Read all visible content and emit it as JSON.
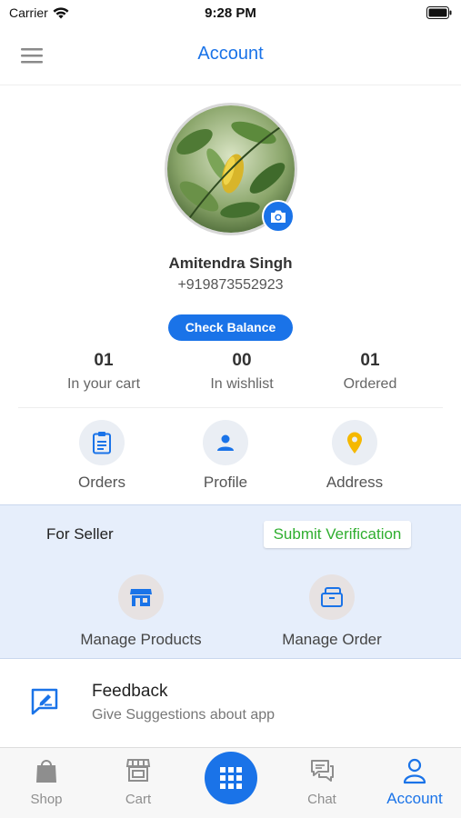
{
  "status_bar": {
    "carrier": "Carrier",
    "time": "9:28 PM"
  },
  "header": {
    "title": "Account",
    "menu_icon": "hamburger-menu-icon"
  },
  "profile": {
    "name": "Amitendra Singh",
    "phone": "+919873552923",
    "check_balance_label": "Check Balance",
    "camera_icon": "camera-icon"
  },
  "stats": [
    {
      "value": "01",
      "label": "In your cart"
    },
    {
      "value": "00",
      "label": "In wishlist"
    },
    {
      "value": "01",
      "label": "Ordered"
    }
  ],
  "quick_links": [
    {
      "label": "Orders",
      "icon": "clipboard-icon"
    },
    {
      "label": "Profile",
      "icon": "person-icon"
    },
    {
      "label": "Address",
      "icon": "location-pin-icon"
    }
  ],
  "seller": {
    "title": "For Seller",
    "verify_label": "Submit Verification",
    "items": [
      {
        "label": "Manage Products",
        "icon": "store-icon"
      },
      {
        "label": "Manage Order",
        "icon": "briefcase-icon"
      }
    ]
  },
  "feedback": {
    "title": "Feedback",
    "subtitle": "Give Suggestions about app",
    "icon": "feedback-icon"
  },
  "tabs": [
    {
      "label": "Shop",
      "icon": "shopping-bag-icon"
    },
    {
      "label": "Cart",
      "icon": "cart-store-icon"
    },
    {
      "label": "",
      "icon": "grid-icon"
    },
    {
      "label": "Chat",
      "icon": "chat-icon"
    },
    {
      "label": "Account",
      "icon": "user-icon"
    }
  ],
  "colors": {
    "accent": "#1a73e8",
    "seller_bg": "#e6eefb",
    "verify_text": "#2fae2f",
    "address_pin": "#f5b800"
  }
}
